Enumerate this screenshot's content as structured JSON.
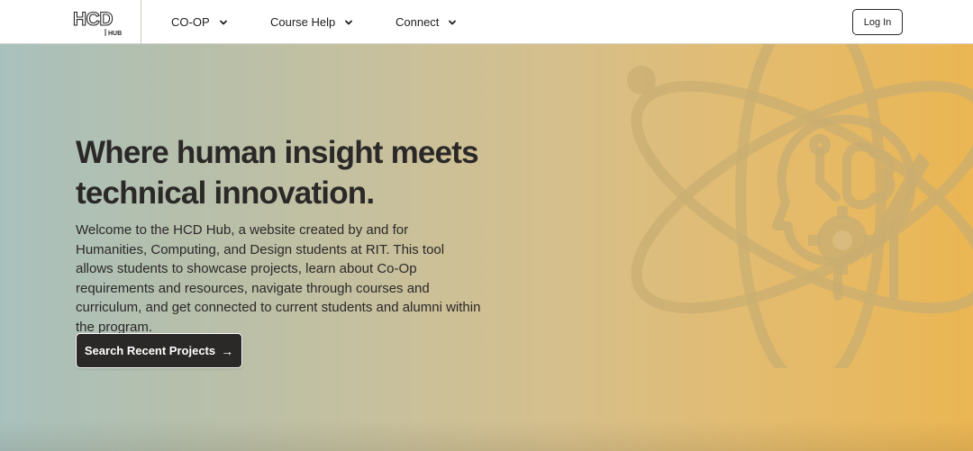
{
  "brand": {
    "logo_text": "HCD",
    "logo_subtext": "HUB"
  },
  "nav": {
    "items": [
      {
        "label": "CO-OP",
        "icon": "chevron-down-icon"
      },
      {
        "label": "Course Help",
        "icon": "chevron-down-icon"
      },
      {
        "label": "Connect",
        "icon": "chevron-down-icon"
      }
    ],
    "login_label": "Log In"
  },
  "hero": {
    "headline_line1": "Where human insight meets",
    "headline_line2": "technical innovation.",
    "intro": "Welcome to the HCD Hub, a website created by and for Humanities, Computing, and Design students at RIT. This tool allows students to showcase projects, learn about Co-Op requirements and resources, navigate through courses and curriculum, and get connected to current students and alumni within the program.",
    "cta_label": "Search Recent Projects",
    "cta_icon": "arrow-right-icon",
    "illustration": "atom-head-gear-brush-icon"
  },
  "colors": {
    "text_dark": "#2b2828",
    "gradient_start": "#a9c1bd",
    "gradient_end": "#ebb653",
    "button_bg": "#2b2828"
  }
}
